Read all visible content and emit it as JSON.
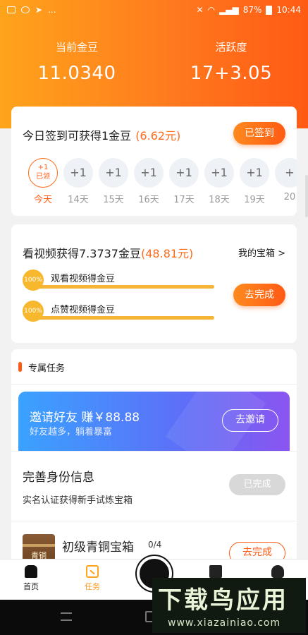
{
  "status": {
    "left_icons": [
      "gallery-icon",
      "chat-icon",
      "telegram-icon",
      "more-icon"
    ],
    "more": "...",
    "battery": "87%",
    "time": "10:44"
  },
  "header": {
    "gold_label": "当前金豆",
    "gold_value": "11.0340",
    "activity_label": "活跃度",
    "activity_value": "17+3.05"
  },
  "sign": {
    "title": "今日签到可获得1金豆",
    "amount": "(6.62元)",
    "button": "已签到",
    "today_coin_top": "+1",
    "today_coin_bottom": "已领",
    "days": [
      {
        "coin": "",
        "label": "今天"
      },
      {
        "coin": "+1",
        "label": "14天"
      },
      {
        "coin": "+1",
        "label": "15天"
      },
      {
        "coin": "+1",
        "label": "16天"
      },
      {
        "coin": "+1",
        "label": "17天"
      },
      {
        "coin": "+1",
        "label": "18天"
      },
      {
        "coin": "+1",
        "label": "19天"
      },
      {
        "coin": "+",
        "label": "20"
      }
    ]
  },
  "video": {
    "title": "看视频获得7.3737金豆",
    "amount": "(48.81元)",
    "treasure_link": "我的宝箱 >",
    "tasks": [
      {
        "pct": "100%",
        "text": "观看视频得金豆",
        "progress": 1.0
      },
      {
        "pct": "100%",
        "text": "点赞视频得金豆",
        "progress": 1.0
      }
    ],
    "button": "去完成"
  },
  "tasks": {
    "section_title": "专属任务",
    "invite": {
      "title": "邀请好友  赚￥88.88",
      "subtitle": "好友越多，躺着暴富",
      "button": "去邀请"
    },
    "identity": {
      "title": "完善身份信息",
      "subtitle": "实名认证获得新手试炼宝箱",
      "button": "已完成"
    },
    "bronze": {
      "chest_text": "青铜",
      "title": "初级青铜宝箱",
      "count": "0/4",
      "button": "去完成"
    }
  },
  "tabbar": {
    "home": "首页",
    "task": "任务",
    "colors": {
      "active": "#ff9a1a"
    }
  },
  "watermark": {
    "big": "下载鸟应用",
    "small": "www.xiazainiao.com"
  },
  "colors": {
    "accent": "#ff5a14",
    "gold": "#ffa41b",
    "blue": "#3aa2ff"
  }
}
